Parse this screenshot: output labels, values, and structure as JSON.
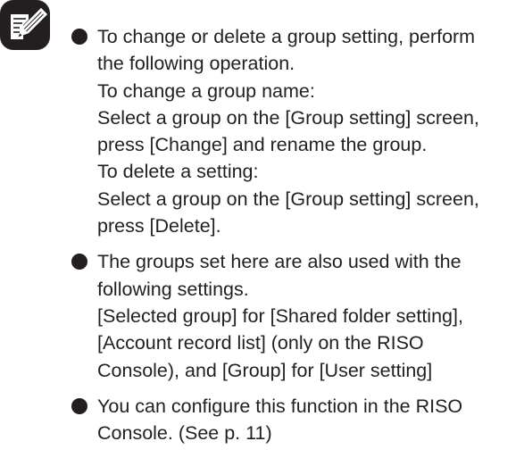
{
  "colors": {
    "text": "#231f20",
    "icon_fill": "#231f20",
    "background": "#ffffff"
  },
  "note": {
    "icon": "note-pencil-icon",
    "items": [
      {
        "lines": [
          "To change or delete a group setting, perform",
          "the following operation.",
          "To change a group name:",
          "Select a group on the [Group setting] screen,",
          "press [Change] and rename the group.",
          "To delete a setting:",
          "Select a group on the [Group setting] screen,",
          "press [Delete]."
        ]
      },
      {
        "lines": [
          "The groups set here are also used with the",
          "following settings.",
          "[Selected group] for [Shared folder setting],",
          "[Account record list] (only on the RISO",
          "Console), and [Group] for [User setting]"
        ]
      },
      {
        "lines": [
          "You can configure this function in the RISO",
          "Console. (See p. 11)"
        ]
      }
    ]
  }
}
